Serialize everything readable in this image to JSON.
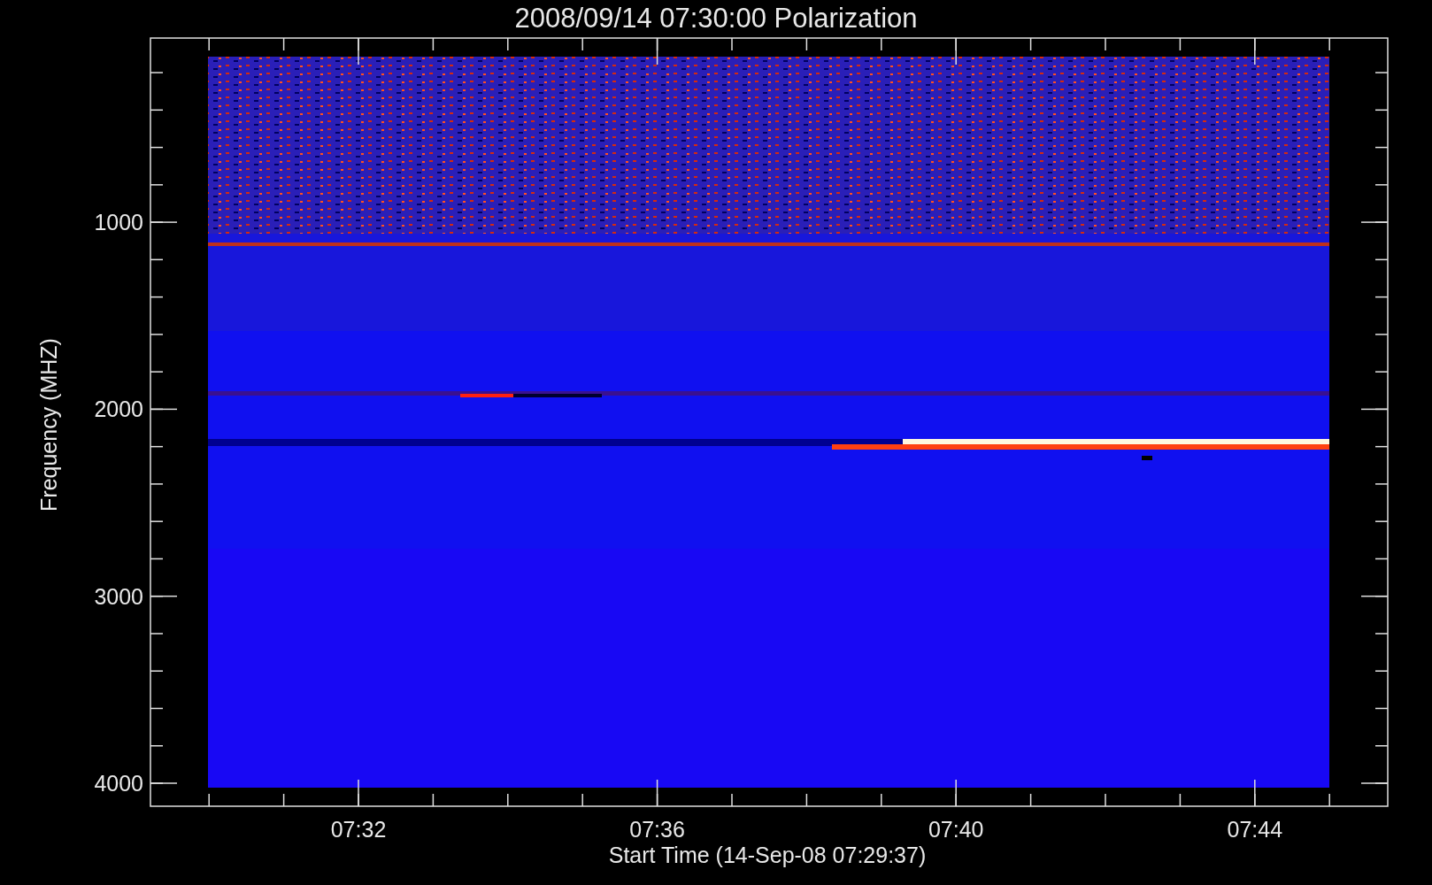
{
  "title": "2008/09/14 07:30:00 Polarization",
  "y_axis": {
    "label": "Frequency (MHZ)",
    "ticks": [
      "1000",
      "2000",
      "3000",
      "4000"
    ]
  },
  "x_axis": {
    "label": "Start Time (14-Sep-08 07:29:37)",
    "ticks": [
      "07:32",
      "07:36",
      "07:40",
      "07:44"
    ]
  }
}
